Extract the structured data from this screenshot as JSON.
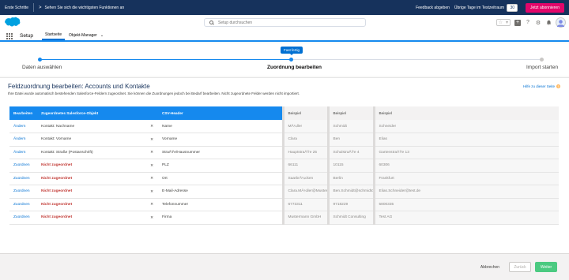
{
  "trial_bar": {
    "first_steps": "Erste Schritte",
    "chevron": ">",
    "message": "Sehen Sie sich die wichtigsten Funktionen an",
    "feedback": "Feedback abgeben",
    "days_label": "Übrige Tage im Testzeitraum",
    "days_remaining": "30",
    "subscribe": "Jetzt abonnieren"
  },
  "header": {
    "search_placeholder": "Setup durchsuchen",
    "colors": {
      "brand": "#1589ee",
      "navy": "#16325c",
      "pink": "#e3066a"
    }
  },
  "app_nav": {
    "app_name": "Setup",
    "tabs": [
      {
        "label": "Startseite",
        "active": true
      },
      {
        "label": "Objekt-Manager",
        "active": false
      }
    ]
  },
  "progress": {
    "tooltip": "Fast fertig",
    "steps": [
      {
        "label": "Daten auswählen",
        "state": "complete"
      },
      {
        "label": "Zuordnung bearbeiten",
        "state": "current"
      },
      {
        "label": "Import starten",
        "state": "incomplete"
      }
    ]
  },
  "panel": {
    "title": "Feldzuordnung bearbeiten: Accounts und Kontakte",
    "help_link": "Hilfe zu dieser Seite",
    "description": "Ihre Datei wurde automatisch bestehenden Salesforce-Feldern zugeordnet. Sie können die Zuordnungen jedoch bei Bedarf bearbeiten. Nicht zugeordnete Felder werden nicht importiert."
  },
  "table": {
    "headers": {
      "action": "Bearbeiten",
      "object": "Zugeordnetes Salesforce-Objekt",
      "csv": "CSV-Header",
      "ex1": "Beispiel",
      "ex2": "Beispiel",
      "ex3": "Beispiel"
    },
    "rows": [
      {
        "action": "Ändern",
        "object": "Kontakt: Nachname",
        "mapped": true,
        "csv": "Name",
        "ex1": "MÃ¼ller",
        "ex2": "Schmidt",
        "ex3": "Schneider"
      },
      {
        "action": "Ändern",
        "object": "Kontakt: Vorname",
        "mapped": true,
        "csv": "Vorname",
        "ex1": "Clara",
        "ex2": "Ben",
        "ex3": "Elias"
      },
      {
        "action": "Ändern",
        "object": "Kontakt: Straße (Postanschrift)",
        "mapped": true,
        "csv": "StraÃŸe/Hausnummer",
        "ex1": "HauptstraÃŸe 25",
        "ex2": "SchulstraÃŸe 4",
        "ex3": "GartenstraÃŸe 13"
      },
      {
        "action": "Zuordnen",
        "object": "Nicht zugeordnet",
        "mapped": false,
        "csv": "PLZ",
        "ex1": "66111",
        "ex2": "10115",
        "ex3": "60306"
      },
      {
        "action": "Zuordnen",
        "object": "Nicht zugeordnet",
        "mapped": false,
        "csv": "Ort",
        "ex1": "SaarbrÃ¼cken",
        "ex2": "Berlin",
        "ex3": "Frankfurt"
      },
      {
        "action": "Zuordnen",
        "object": "Nicht zugeordnet",
        "mapped": false,
        "csv": "E-Mail-Adresse",
        "ex1": "Clara.MÃ¼ller@Mustermann",
        "ex2": "Ben.Schmidt@schmidtconsulting",
        "ex3": "Elias.Schneider@test.de"
      },
      {
        "action": "Zuordnen",
        "object": "Nicht zugeordnet",
        "mapped": false,
        "csv": "Telefonnummer",
        "ex1": "6773311",
        "ex2": "9718229",
        "ex3": "5800335"
      },
      {
        "action": "Zuordnen",
        "object": "Nicht zugeordnet",
        "mapped": false,
        "csv": "Firma",
        "ex1": "Mustermann GmbH",
        "ex2": "Schmidt Consulting",
        "ex3": "Test AG"
      }
    ]
  },
  "footer": {
    "cancel": "Abbrechen",
    "back": "Zurück",
    "next": "Weiter"
  }
}
